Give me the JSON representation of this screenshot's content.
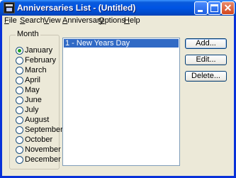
{
  "window": {
    "title": "Anniversaries List - (Untitled)"
  },
  "titlebar_buttons": {
    "minimize_glyph": "minimize-icon",
    "maximize_glyph": "maximize-icon",
    "close_glyph": "✕"
  },
  "menu": [
    {
      "prefix": "",
      "u": "F",
      "rest": "ile"
    },
    {
      "prefix": "",
      "u": "S",
      "rest": "earch"
    },
    {
      "prefix": "",
      "u": "V",
      "rest": "iew"
    },
    {
      "prefix": "",
      "u": "A",
      "rest": "nniversary"
    },
    {
      "prefix": "",
      "u": "O",
      "rest": "ptions"
    },
    {
      "prefix": "",
      "u": "H",
      "rest": "elp"
    }
  ],
  "month_group": {
    "label": "Month",
    "selected": "January",
    "months": [
      "January",
      "February",
      "March",
      "April",
      "May",
      "June",
      "July",
      "August",
      "September",
      "October",
      "November",
      "December"
    ]
  },
  "list": {
    "items": [
      "1 - New Years Day"
    ],
    "selected_index": 0
  },
  "buttons": {
    "add": "Add...",
    "edit": "Edit...",
    "delete": "Delete..."
  },
  "colors": {
    "titlebar": "#0054e3",
    "selection": "#316ac5",
    "window_bg": "#ece9d8"
  }
}
